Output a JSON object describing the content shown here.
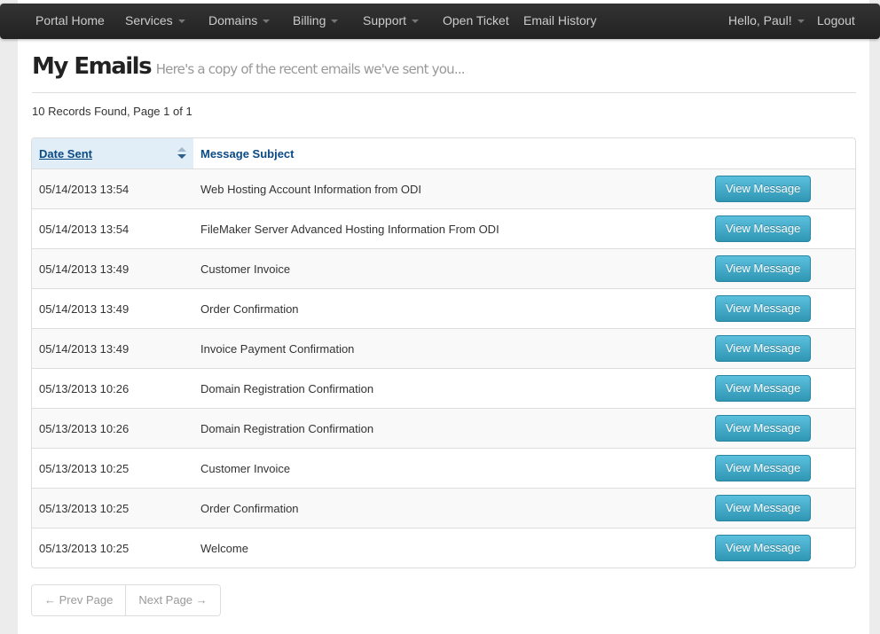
{
  "navbar": {
    "items": [
      {
        "label": "Portal Home",
        "dropdown": false
      },
      {
        "label": "Services",
        "dropdown": true
      },
      {
        "label": "Domains",
        "dropdown": true
      },
      {
        "label": "Billing",
        "dropdown": true
      },
      {
        "label": "Support",
        "dropdown": true
      },
      {
        "label": "Open Ticket",
        "dropdown": false
      },
      {
        "label": "Email History",
        "dropdown": false
      }
    ],
    "user_menu": "Hello, Paul!",
    "logout": "Logout"
  },
  "header": {
    "title": "My Emails",
    "subtitle": "Here's a copy of the recent emails we've sent you..."
  },
  "records_info": "10 Records Found, Page 1 of 1",
  "table": {
    "columns": [
      "Date Sent",
      "Message Subject",
      ""
    ],
    "sorted_column": "Date Sent",
    "button_label": "View Message",
    "rows": [
      {
        "date": "05/14/2013 13:54",
        "subject": "Web Hosting Account Information from ODI"
      },
      {
        "date": "05/14/2013 13:54",
        "subject": "FileMaker Server Advanced Hosting Information From ODI"
      },
      {
        "date": "05/14/2013 13:49",
        "subject": "Customer Invoice"
      },
      {
        "date": "05/14/2013 13:49",
        "subject": "Order Confirmation"
      },
      {
        "date": "05/14/2013 13:49",
        "subject": "Invoice Payment Confirmation"
      },
      {
        "date": "05/13/2013 10:26",
        "subject": "Domain Registration Confirmation"
      },
      {
        "date": "05/13/2013 10:26",
        "subject": "Domain Registration Confirmation"
      },
      {
        "date": "05/13/2013 10:25",
        "subject": "Customer Invoice"
      },
      {
        "date": "05/13/2013 10:25",
        "subject": "Order Confirmation"
      },
      {
        "date": "05/13/2013 10:25",
        "subject": "Welcome"
      }
    ]
  },
  "pager": {
    "prev": "← Prev Page",
    "next": "Next Page →"
  },
  "colors": {
    "navbar_bg": "#222222",
    "link_blue": "#0a4a85",
    "info_button": "#49afcd"
  }
}
